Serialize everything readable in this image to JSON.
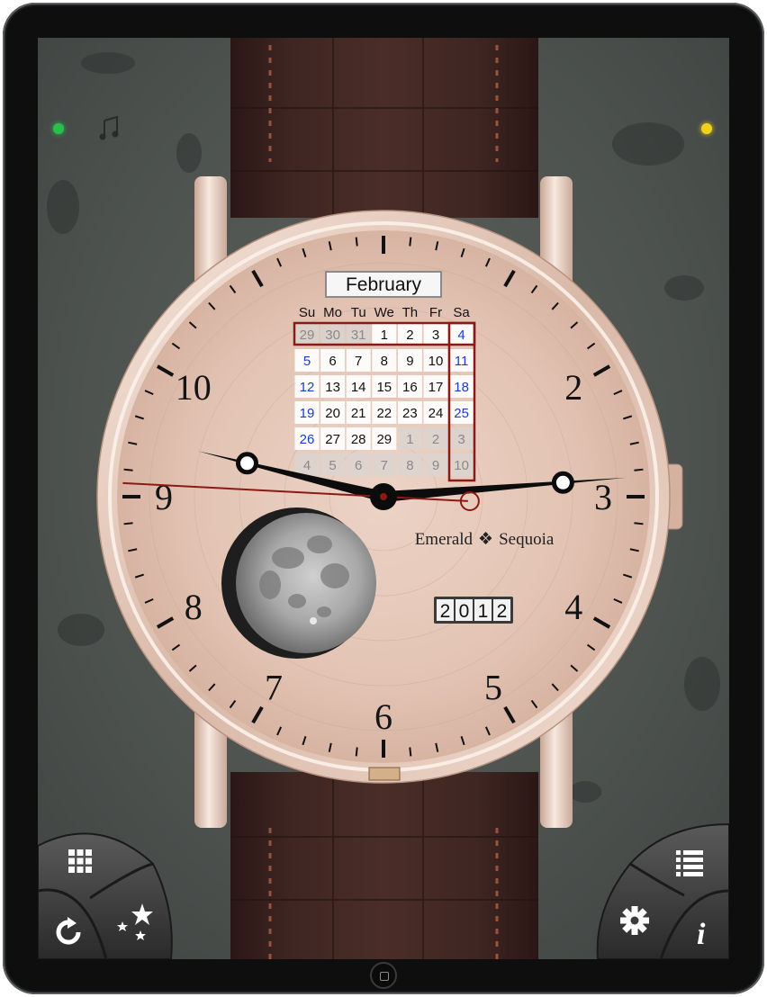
{
  "watch": {
    "brand_left": "Emerald",
    "brand_right": "Sequoia",
    "year_digits": [
      "2",
      "0",
      "1",
      "2"
    ],
    "hour_numerals": [
      {
        "n": "2",
        "h": 2
      },
      {
        "n": "3",
        "h": 3
      },
      {
        "n": "4",
        "h": 4
      },
      {
        "n": "5",
        "h": 5
      },
      {
        "n": "6",
        "h": 6
      },
      {
        "n": "7",
        "h": 7
      },
      {
        "n": "8",
        "h": 8
      },
      {
        "n": "9",
        "h": 9
      },
      {
        "n": "10",
        "h": 10
      }
    ],
    "time": {
      "hour": 2.85,
      "minute": 47.3,
      "second": 15.5
    }
  },
  "calendar": {
    "month": "February",
    "weekdays": [
      "Su",
      "Mo",
      "Tu",
      "We",
      "Th",
      "Fr",
      "Sa"
    ],
    "weeks": [
      [
        {
          "d": "29",
          "cur": false
        },
        {
          "d": "30",
          "cur": false
        },
        {
          "d": "31",
          "cur": false
        },
        {
          "d": "1",
          "cur": true
        },
        {
          "d": "2",
          "cur": true
        },
        {
          "d": "3",
          "cur": true
        },
        {
          "d": "4",
          "cur": true
        }
      ],
      [
        {
          "d": "5",
          "cur": true
        },
        {
          "d": "6",
          "cur": true
        },
        {
          "d": "7",
          "cur": true
        },
        {
          "d": "8",
          "cur": true
        },
        {
          "d": "9",
          "cur": true
        },
        {
          "d": "10",
          "cur": true
        },
        {
          "d": "11",
          "cur": true
        }
      ],
      [
        {
          "d": "12",
          "cur": true
        },
        {
          "d": "13",
          "cur": true
        },
        {
          "d": "14",
          "cur": true
        },
        {
          "d": "15",
          "cur": true
        },
        {
          "d": "16",
          "cur": true
        },
        {
          "d": "17",
          "cur": true
        },
        {
          "d": "18",
          "cur": true
        }
      ],
      [
        {
          "d": "19",
          "cur": true
        },
        {
          "d": "20",
          "cur": true
        },
        {
          "d": "21",
          "cur": true
        },
        {
          "d": "22",
          "cur": true
        },
        {
          "d": "23",
          "cur": true
        },
        {
          "d": "24",
          "cur": true
        },
        {
          "d": "25",
          "cur": true
        }
      ],
      [
        {
          "d": "26",
          "cur": true
        },
        {
          "d": "27",
          "cur": true
        },
        {
          "d": "28",
          "cur": true
        },
        {
          "d": "29",
          "cur": true
        },
        {
          "d": "1",
          "cur": false
        },
        {
          "d": "2",
          "cur": false
        },
        {
          "d": "3",
          "cur": false
        }
      ],
      [
        {
          "d": "4",
          "cur": false
        },
        {
          "d": "5",
          "cur": false
        },
        {
          "d": "6",
          "cur": false
        },
        {
          "d": "7",
          "cur": false
        },
        {
          "d": "8",
          "cur": false
        },
        {
          "d": "9",
          "cur": false
        },
        {
          "d": "10",
          "cur": false
        }
      ]
    ]
  },
  "colors": {
    "dial": "#e2c2b2",
    "case": "#e6cabd",
    "strap": "#3b2320",
    "weekend_blue": "#1a3cd0",
    "highlight_red": "#8c1a14",
    "status_green": "#27c04a",
    "status_yellow": "#f0d21c"
  },
  "controls": {
    "bottom_left": [
      "grid-icon",
      "refresh-icon",
      "stars-icon"
    ],
    "bottom_right": [
      "list-icon",
      "gear-icon",
      "info-icon"
    ],
    "top_left": [
      "status-green-dot",
      "music-note-icon"
    ],
    "top_right": [
      "status-yellow-dot"
    ]
  }
}
